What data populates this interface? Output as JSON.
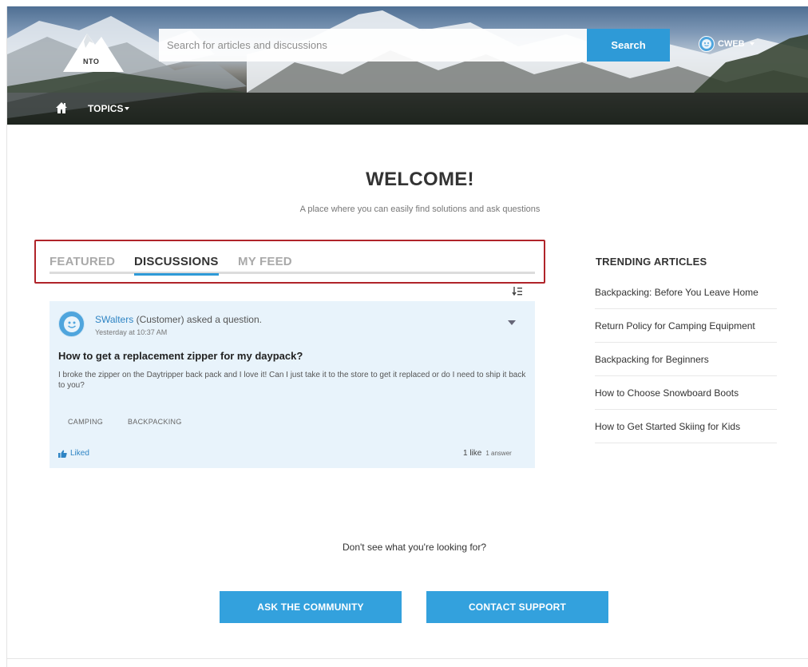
{
  "header": {
    "logo_text": "NTO",
    "search": {
      "placeholder": "Search for articles and discussions",
      "value": "",
      "button_label": "Search"
    },
    "user": {
      "name": "CWEB"
    },
    "nav": {
      "topics_label": "TOPICS"
    }
  },
  "welcome": {
    "title": "WELCOME!",
    "tagline": "A place where you can easily find solutions and ask questions"
  },
  "tabs": [
    {
      "label": "FEATURED",
      "active": false
    },
    {
      "label": "DISCUSSIONS",
      "active": true
    },
    {
      "label": "MY FEED",
      "active": false
    }
  ],
  "feed": {
    "post": {
      "author": "SWalters",
      "author_meta": " (Customer) asked a question.",
      "timestamp": "Yesterday at 10:37 AM",
      "title": "How to get a replacement zipper for my daypack?",
      "body": "I broke the zipper on the Daytripper back pack and I love it! Can I just take it to the store to get it replaced or do I need to ship it back to you?",
      "topics": [
        "CAMPING",
        "BACKPACKING"
      ],
      "liked_label": "Liked",
      "likes": "1 like",
      "answers": "1 answer"
    }
  },
  "trending": {
    "title": "TRENDING ARTICLES",
    "items": [
      "Backpacking: Before You Leave Home",
      "Return Policy for Camping Equipment",
      "Backpacking for Beginners",
      "How to Choose Snowboard Boots",
      "How to Get Started Skiing for Kids"
    ]
  },
  "footer": {
    "prompt": "Don't see what you're looking for?",
    "ask_label": "ASK THE COMMUNITY",
    "contact_label": "CONTACT SUPPORT"
  },
  "colors": {
    "accent": "#2e9ad7",
    "highlight_border": "#b0242a",
    "card_bg": "#e8f3fb"
  }
}
